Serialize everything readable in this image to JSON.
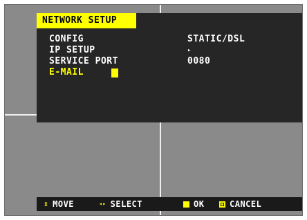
{
  "menu": {
    "title": "NETWORK SETUP",
    "rows": [
      {
        "label": "CONFIG",
        "value": "STATIC/DSL"
      },
      {
        "label": "IP SETUP",
        "value": "▸"
      },
      {
        "label": "SERVICE PORT",
        "value": "0080"
      },
      {
        "label": "E-MAIL",
        "value": ""
      }
    ],
    "selected_row": "E-MAIL"
  },
  "footer": {
    "move_icon": "⇕",
    "move_label": "MOVE",
    "select_icon": "◂▸",
    "select_label": "SELECT",
    "ok_label": "OK",
    "cancel_label": "CANCEL"
  },
  "colors": {
    "highlight": "#ffff00",
    "panel": "#262626",
    "background": "#8a8a8a"
  }
}
